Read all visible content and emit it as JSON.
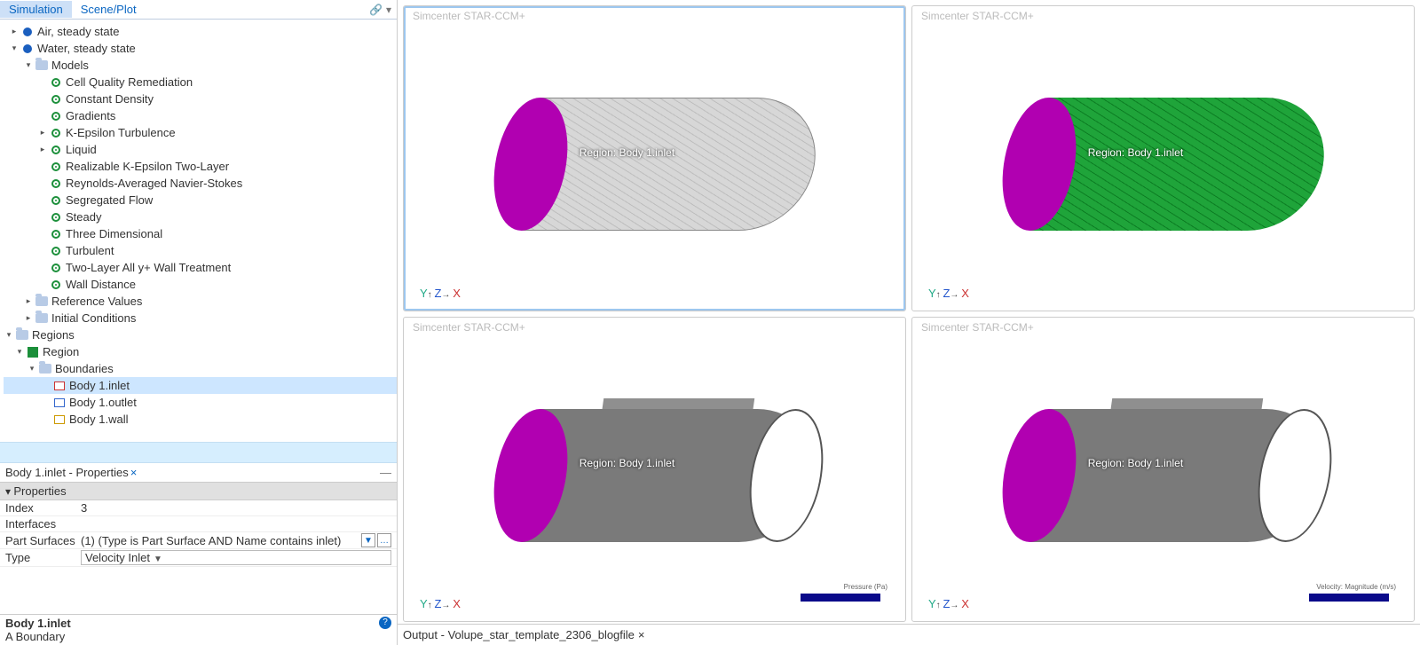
{
  "tabs": {
    "simulation": "Simulation",
    "scene": "Scene/Plot"
  },
  "tree": {
    "air": "Air, steady state",
    "water": "Water, steady state",
    "models": "Models",
    "model_items": [
      "Cell Quality Remediation",
      "Constant Density",
      "Gradients",
      "K-Epsilon Turbulence",
      "Liquid",
      "Realizable K-Epsilon Two-Layer",
      "Reynolds-Averaged Navier-Stokes",
      "Segregated Flow",
      "Steady",
      "Three Dimensional",
      "Turbulent",
      "Two-Layer All y+ Wall Treatment",
      "Wall Distance"
    ],
    "ref": "Reference Values",
    "ic": "Initial Conditions",
    "regions": "Regions",
    "region": "Region",
    "boundaries": "Boundaries",
    "b_inlet": "Body 1.inlet",
    "b_outlet": "Body 1.outlet",
    "b_wall": "Body 1.wall"
  },
  "props": {
    "title": "Body 1.inlet - Properties",
    "section": "Properties",
    "rows": {
      "index_lbl": "Index",
      "index_val": "3",
      "ifc_lbl": "Interfaces",
      "ifc_val": "",
      "ps_lbl": "Part Surfaces",
      "ps_val": "(1) (Type is Part Surface AND Name contains inlet)",
      "type_lbl": "Type",
      "type_val": "Velocity Inlet"
    }
  },
  "desc": {
    "title": "Body 1.inlet",
    "sub": "A Boundary"
  },
  "scenes": {
    "brand": "Simcenter STAR-CCM+",
    "region_label": "Region: Body 1.inlet",
    "pressure": "Pressure (Pa)",
    "velocity": "Velocity: Magnitude (m/s)"
  },
  "output": "Output - Volupe_star_template_2306_blogfile"
}
